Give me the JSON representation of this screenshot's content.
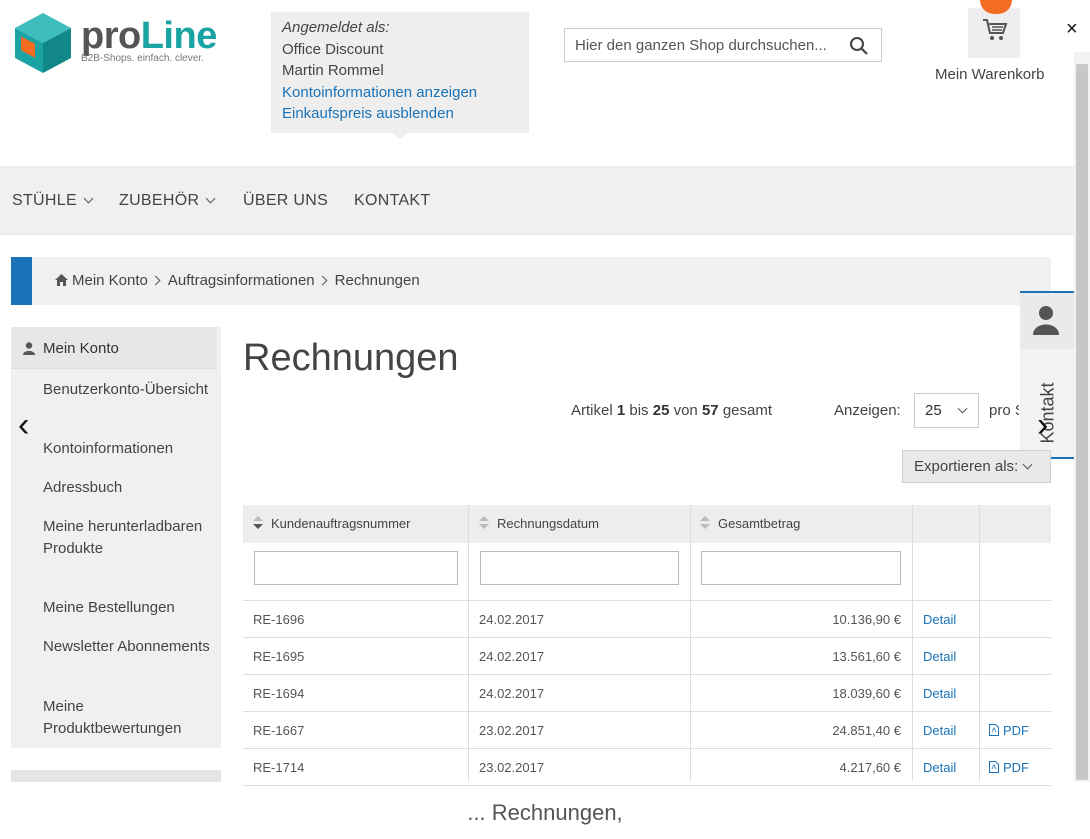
{
  "header": {
    "logo_text_main": "pro",
    "logo_text_accent": "Line",
    "logo_tagline": "B2B-Shops. einfach. clever.",
    "login": {
      "label": "Angemeldet als:",
      "company": "Office Discount",
      "user": "Martin Rommel",
      "link_account": "Kontoinformationen anzeigen",
      "link_price": "Einkaufspreis ausblenden"
    },
    "search_placeholder": "Hier den ganzen Shop durchsuchen...",
    "cart_label": "Mein Warenkorb",
    "close": "×"
  },
  "nav": {
    "items": [
      {
        "label": "STÜHLE",
        "dropdown": true
      },
      {
        "label": "ZUBEHÖR",
        "dropdown": true
      },
      {
        "label": "ÜBER UNS",
        "dropdown": false
      },
      {
        "label": "KONTAKT",
        "dropdown": false
      }
    ]
  },
  "breadcrumb": [
    "Mein Konto",
    "Auftragsinformationen",
    "Rechnungen"
  ],
  "sidebar": {
    "title": "Mein Konto",
    "items": [
      "Benutzerkonto-Übersicht",
      "Kontoinformationen",
      "Adressbuch",
      "Meine herunterladbaren Produkte",
      "Meine Bestellungen",
      "Newsletter Abonnements",
      "Meine Produktbewertungen"
    ]
  },
  "kontakt_widget": "Kontakt",
  "carousel": {
    "prev": "‹",
    "next": "›"
  },
  "main": {
    "title": "Rechnungen",
    "pager": {
      "prefix": "Artikel",
      "from": "1",
      "bis": "bis",
      "to": "25",
      "von": "von",
      "total": "57",
      "suffix": "gesamt"
    },
    "show_label": "Anzeigen:",
    "limit_value": "25",
    "per_label": "pro Seite",
    "export_label": "Exportieren als:",
    "table": {
      "columns": [
        "Kundenauftragsnummer",
        "Rechnungsdatum",
        "Gesamtbetrag",
        "",
        ""
      ],
      "rows": [
        {
          "number": "RE-1696",
          "date": "24.02.2017",
          "amount": "10.136,90 €",
          "detail": "Detail",
          "pdf": ""
        },
        {
          "number": "RE-1695",
          "date": "24.02.2017",
          "amount": "13.561,60 €",
          "detail": "Detail",
          "pdf": ""
        },
        {
          "number": "RE-1694",
          "date": "24.02.2017",
          "amount": "18.039,60 €",
          "detail": "Detail",
          "pdf": ""
        },
        {
          "number": "RE-1667",
          "date": "23.02.2017",
          "amount": "24.851,40 €",
          "detail": "Detail",
          "pdf": "PDF"
        },
        {
          "number": "RE-1714",
          "date": "23.02.2017",
          "amount": "4.217,60 €",
          "detail": "Detail",
          "pdf": "PDF"
        }
      ]
    }
  },
  "caption": "... Rechnungen,",
  "colors": {
    "accent": "#1a73b8",
    "brand_teal": "#1aa3a3",
    "badge": "#f26c21"
  },
  "icons": [
    "logo-cube-icon",
    "search-icon",
    "cart-icon",
    "close-icon",
    "home-icon",
    "user-icon",
    "chevron-down-icon",
    "chevron-right-icon",
    "sort-icon",
    "pdf-icon",
    "arrow-left-icon",
    "arrow-right-icon"
  ]
}
